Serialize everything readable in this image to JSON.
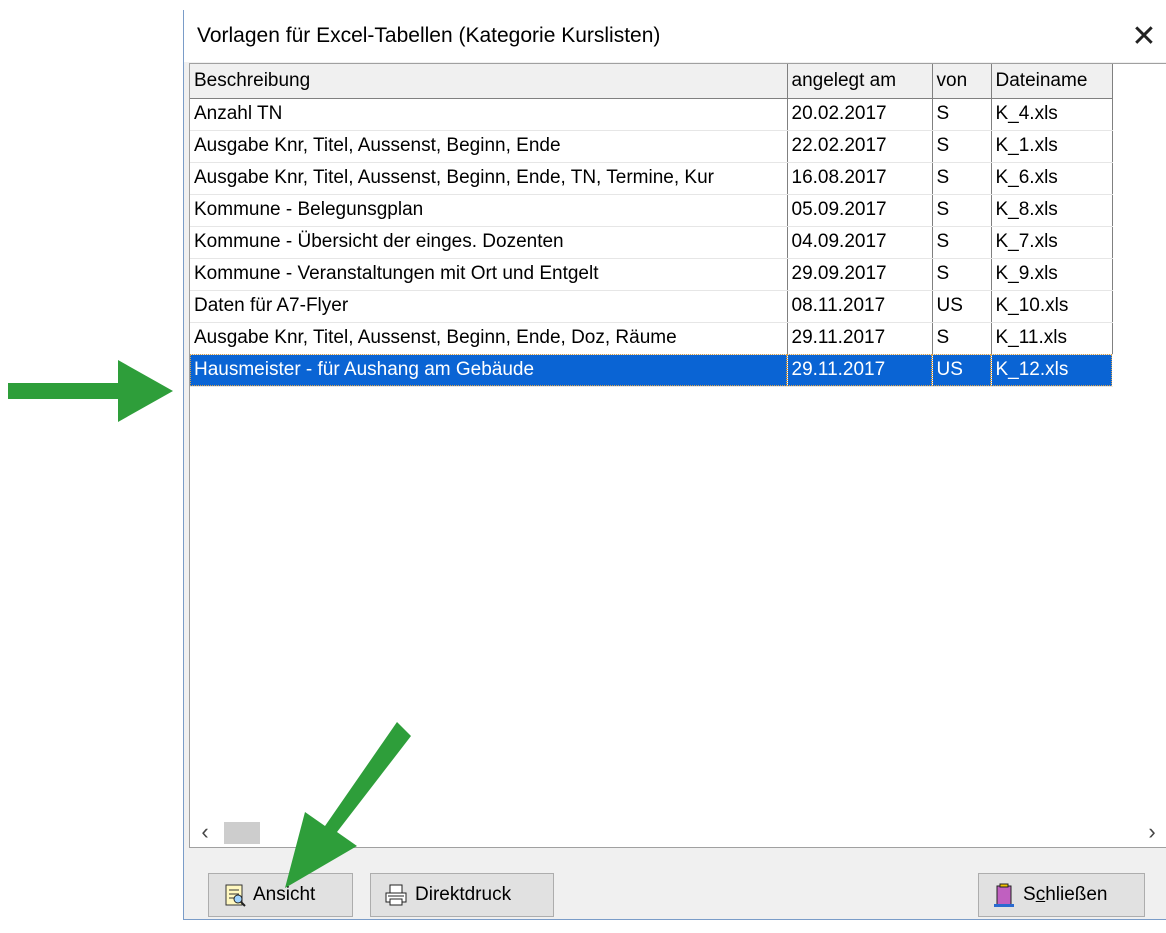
{
  "window": {
    "title": "Vorlagen für Excel-Tabellen  (Kategorie Kurslisten)",
    "close_glyph": "✕"
  },
  "table": {
    "columns": [
      "Beschreibung",
      "angelegt am",
      "von",
      "Dateiname"
    ],
    "rows": [
      [
        "Anzahl TN",
        "20.02.2017",
        "S",
        "K_4.xls"
      ],
      [
        "Ausgabe Knr, Titel, Aussenst, Beginn, Ende",
        "22.02.2017",
        "S",
        "K_1.xls"
      ],
      [
        "Ausgabe Knr, Titel, Aussenst, Beginn, Ende, TN, Termine, Kur",
        "16.08.2017",
        "S",
        "K_6.xls"
      ],
      [
        "Kommune - Belegunsgplan",
        "05.09.2017",
        "S",
        "K_8.xls"
      ],
      [
        "Kommune - Übersicht der einges. Dozenten",
        "04.09.2017",
        "S",
        "K_7.xls"
      ],
      [
        "Kommune - Veranstaltungen mit Ort und Entgelt",
        "29.09.2017",
        "S",
        "K_9.xls"
      ],
      [
        "Daten für A7-Flyer",
        "08.11.2017",
        "US",
        "K_10.xls"
      ],
      [
        "Ausgabe Knr, Titel, Aussenst, Beginn, Ende, Doz, Räume",
        "29.11.2017",
        "S",
        "K_11.xls"
      ],
      [
        "Hausmeister - für Aushang am Gebäude",
        "29.11.2017",
        "US",
        "K_12.xls"
      ]
    ],
    "selected_index": 8
  },
  "scrollbar": {
    "left_glyph": "‹",
    "right_glyph": "›"
  },
  "buttons": {
    "ansicht": "Ansicht",
    "direktdruck": "Direktdruck",
    "schliessen_prefix": "S",
    "schliessen_underlined": "c",
    "schliessen_rest": "hließen"
  },
  "colors": {
    "selection": "#0a64d4",
    "arrow": "#2e9e3a"
  }
}
